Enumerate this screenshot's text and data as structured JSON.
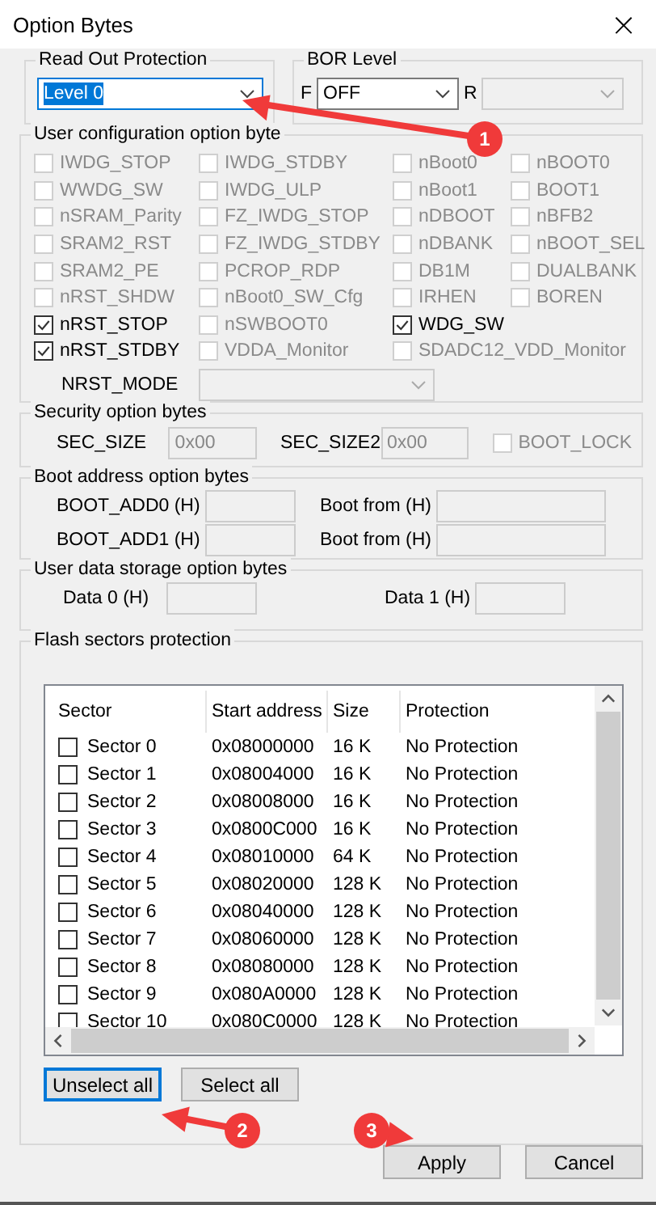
{
  "window": {
    "title": "Option Bytes",
    "close": "×"
  },
  "read_out_protection": {
    "legend": "Read Out Protection",
    "value": "Level 0",
    "focused": true
  },
  "bor_level": {
    "legend": "BOR Level",
    "fields": [
      {
        "label": "F",
        "value": "OFF",
        "disabled": false
      },
      {
        "label": "R",
        "disabled": true
      }
    ]
  },
  "user_config": {
    "legend": "User configuration option byte",
    "rows": [
      [
        {
          "label": "IWDG_STOP",
          "checked": false,
          "disabled": true
        },
        {
          "label": "IWDG_STDBY",
          "checked": false,
          "disabled": true
        },
        {
          "label": "nBoot0",
          "checked": false,
          "disabled": true
        },
        {
          "label": "nBOOT0",
          "checked": false,
          "disabled": true
        }
      ],
      [
        {
          "label": "WWDG_SW",
          "checked": false,
          "disabled": true
        },
        {
          "label": "IWDG_ULP",
          "checked": false,
          "disabled": true
        },
        {
          "label": "nBoot1",
          "checked": false,
          "disabled": true
        },
        {
          "label": "BOOT1",
          "checked": false,
          "disabled": true
        }
      ],
      [
        {
          "label": "nSRAM_Parity",
          "checked": false,
          "disabled": true
        },
        {
          "label": "FZ_IWDG_STOP",
          "checked": false,
          "disabled": true
        },
        {
          "label": "nDBOOT",
          "checked": false,
          "disabled": true
        },
        {
          "label": "nBFB2",
          "checked": false,
          "disabled": true
        }
      ],
      [
        {
          "label": "SRAM2_RST",
          "checked": false,
          "disabled": true
        },
        {
          "label": "FZ_IWDG_STDBY",
          "checked": false,
          "disabled": true
        },
        {
          "label": "nDBANK",
          "checked": false,
          "disabled": true
        },
        {
          "label": "nBOOT_SEL",
          "checked": false,
          "disabled": true
        }
      ],
      [
        {
          "label": "SRAM2_PE",
          "checked": false,
          "disabled": true
        },
        {
          "label": "PCROP_RDP",
          "checked": false,
          "disabled": true
        },
        {
          "label": "DB1M",
          "checked": false,
          "disabled": true
        },
        {
          "label": "DUALBANK",
          "checked": false,
          "disabled": true
        }
      ],
      [
        {
          "label": "nRST_SHDW",
          "checked": false,
          "disabled": true
        },
        {
          "label": "nBoot0_SW_Cfg",
          "checked": false,
          "disabled": true
        },
        {
          "label": "IRHEN",
          "checked": false,
          "disabled": true
        },
        {
          "label": "BOREN",
          "checked": false,
          "disabled": true
        }
      ],
      [
        {
          "label": "nRST_STOP",
          "checked": true,
          "disabled": false
        },
        {
          "label": "nSWBOOT0",
          "checked": false,
          "disabled": true
        },
        {
          "label": "WDG_SW",
          "checked": true,
          "disabled": false
        }
      ],
      [
        {
          "label": "nRST_STDBY",
          "checked": true,
          "disabled": false
        },
        {
          "label": "VDDA_Monitor",
          "checked": false,
          "disabled": true
        },
        {
          "label": "SDADC12_VDD_Monitor",
          "checked": false,
          "disabled": true
        }
      ]
    ],
    "nrst_mode": {
      "label": "NRST_MODE",
      "disabled": true
    }
  },
  "security": {
    "legend": "Security option bytes",
    "fields": [
      {
        "label": "SEC_SIZE",
        "value": "0x00",
        "disabled": true
      },
      {
        "label": "SEC_SIZE2",
        "value": "0x00",
        "disabled": true
      }
    ],
    "boot_lock": {
      "label": "BOOT_LOCK",
      "checked": false,
      "disabled": true
    }
  },
  "boot_address": {
    "legend": "Boot address option bytes",
    "rows": [
      [
        {
          "label": "BOOT_ADD0 (H)",
          "disabled": true
        },
        {
          "label": "Boot from (H)",
          "disabled": true
        }
      ],
      [
        {
          "label": "BOOT_ADD1 (H)",
          "disabled": true
        },
        {
          "label": "Boot from (H)",
          "disabled": true
        }
      ]
    ]
  },
  "user_data": {
    "legend": "User data storage option bytes",
    "fields": [
      {
        "label": "Data 0 (H)",
        "disabled": true
      },
      {
        "label": "Data 1 (H)",
        "disabled": true
      }
    ]
  },
  "flash_protection": {
    "legend": "Flash sectors protection",
    "table": {
      "columns": [
        "Sector",
        "Start address",
        "Size",
        "Protection"
      ],
      "rows": [
        {
          "sector": "Sector 0",
          "address": "0x08000000",
          "size": "16 K",
          "protection": "No Protection",
          "checked": false
        },
        {
          "sector": "Sector 1",
          "address": "0x08004000",
          "size": "16 K",
          "protection": "No Protection",
          "checked": false
        },
        {
          "sector": "Sector 2",
          "address": "0x08008000",
          "size": "16 K",
          "protection": "No Protection",
          "checked": false
        },
        {
          "sector": "Sector 3",
          "address": "0x0800C000",
          "size": "16 K",
          "protection": "No Protection",
          "checked": false
        },
        {
          "sector": "Sector 4",
          "address": "0x08010000",
          "size": "64 K",
          "protection": "No Protection",
          "checked": false
        },
        {
          "sector": "Sector 5",
          "address": "0x08020000",
          "size": "128 K",
          "protection": "No Protection",
          "checked": false
        },
        {
          "sector": "Sector 6",
          "address": "0x08040000",
          "size": "128 K",
          "protection": "No Protection",
          "checked": false
        },
        {
          "sector": "Sector 7",
          "address": "0x08060000",
          "size": "128 K",
          "protection": "No Protection",
          "checked": false
        },
        {
          "sector": "Sector 8",
          "address": "0x08080000",
          "size": "128 K",
          "protection": "No Protection",
          "checked": false
        },
        {
          "sector": "Sector 9",
          "address": "0x080A0000",
          "size": "128 K",
          "protection": "No Protection",
          "checked": false
        },
        {
          "sector": "Sector 10",
          "address": "0x080C0000",
          "size": "128 K",
          "protection": "No Protection",
          "checked": false
        }
      ]
    },
    "buttons": [
      {
        "label": "Unselect all",
        "focused": true
      },
      {
        "label": "Select all",
        "focused": false
      }
    ]
  },
  "footer_buttons": [
    {
      "label": "Apply"
    },
    {
      "label": "Cancel"
    }
  ],
  "annotations": [
    {
      "number": "1"
    },
    {
      "number": "2"
    },
    {
      "number": "3"
    }
  ]
}
